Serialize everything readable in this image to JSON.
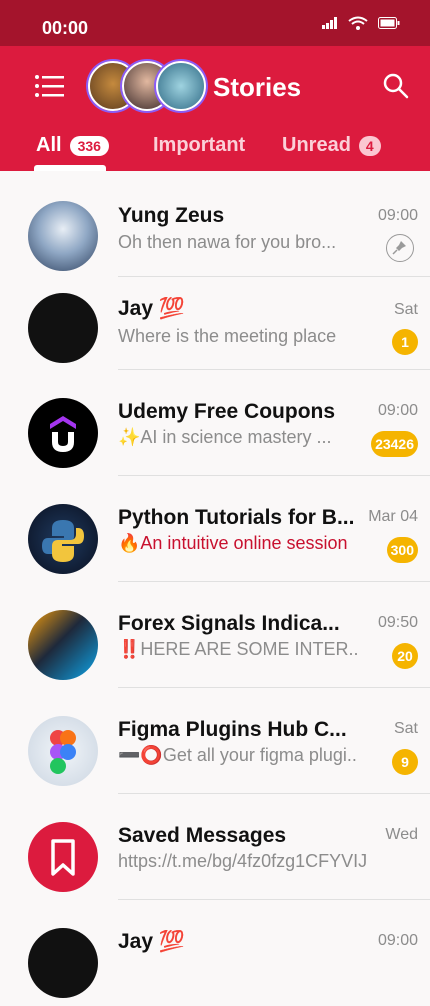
{
  "status": {
    "time": "00:00"
  },
  "header": {
    "title": "Stories"
  },
  "tabs": [
    {
      "label": "All",
      "badge": "336"
    },
    {
      "label": "Important"
    },
    {
      "label": "Unread",
      "badge": "4"
    }
  ],
  "chats": [
    {
      "name": "Yung Zeus",
      "message": "Oh  then nawa for you bro...",
      "time": "09:00",
      "pinned": true
    },
    {
      "name": "Jay 💯",
      "message": "Where is the meeting place",
      "time": "Sat",
      "count": "1"
    },
    {
      "name": "Udemy Free Coupons",
      "message": "✨AI in science mastery ...",
      "time": "09:00",
      "count": "23426"
    },
    {
      "name": "Python Tutorials for B...",
      "message": "🔥An intuitive online session",
      "time": "Mar 04",
      "count": "300"
    },
    {
      "name": "Forex Signals Indica...",
      "message": "‼️HERE ARE SOME  INTER..",
      "time": "09:50",
      "count": "20"
    },
    {
      "name": "Figma Plugins Hub C...",
      "message": "➖⭕Get all your figma plugi..",
      "time": "Sat",
      "count": "9"
    },
    {
      "name": "Saved Messages",
      "message": "https://t.me/bg/4fz0fzg1CFYVIJ..",
      "time": "Wed"
    },
    {
      "name": "Jay 💯",
      "message": "",
      "time": "09:00"
    }
  ],
  "colors": {
    "brand": "#dc1b3e",
    "status_bar": "#a4142c",
    "badge": "#f5b400"
  }
}
